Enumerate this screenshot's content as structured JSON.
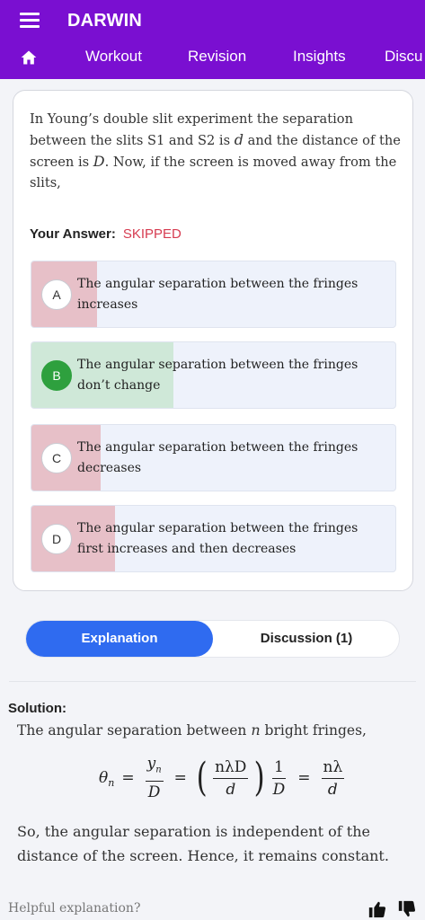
{
  "app": {
    "title": "DARWIN"
  },
  "nav": {
    "tabs": [
      {
        "label": "Workout"
      },
      {
        "label": "Revision"
      },
      {
        "label": "Insights"
      },
      {
        "label": "Discu"
      }
    ]
  },
  "question": {
    "text_part1": "In Young’s double slit experiment the separation between the slits S1 and S2 is ",
    "symbol_d": "d",
    "text_part2": " and the distance of the screen is ",
    "symbol_D": "D",
    "text_part3": ". Now, if the screen is moved away from the slits,"
  },
  "answer": {
    "label": "Your Answer:",
    "status": "SKIPPED"
  },
  "options": [
    {
      "letter": "A",
      "text": "The angular separation between the fringes increases",
      "state": "wrong",
      "fill_fraction": 0.18
    },
    {
      "letter": "B",
      "text": "The angular separation between the fringes don’t change",
      "state": "correct",
      "fill_fraction": 0.39
    },
    {
      "letter": "C",
      "text": "The angular separation between the fringes decreases",
      "state": "wrong",
      "fill_fraction": 0.19
    },
    {
      "letter": "D",
      "text": "The angular separation between the fringes first increases and then decreases",
      "state": "wrong",
      "fill_fraction": 0.23
    }
  ],
  "segment": {
    "explanation": "Explanation",
    "discussion": "Discussion (1)"
  },
  "solution": {
    "title": "Solution:",
    "line1_a": "The angular separation between ",
    "line1_n": "n",
    "line1_b": " bright fringes,",
    "formula": {
      "theta": "θ",
      "sub_n": "n",
      "y": "y",
      "D": "D",
      "num2": "nλD",
      "den2": "d",
      "one": "1",
      "num4": "nλ",
      "den4": "d"
    },
    "paragraph": "So, the angular separation is independent of the distance of the screen. Hence, it remains constant."
  },
  "feedback": {
    "prompt": "Helpful explanation?"
  },
  "colors": {
    "header": "#7a0fd1",
    "skipped": "#d63b50",
    "correct": "#2ea03e",
    "wrong_fill": "#e7c0c8",
    "correct_fill": "#cfe8d8",
    "active_segment": "#2f6bf0"
  },
  "icons": [
    "menu-icon",
    "home-icon",
    "thumbs-up-icon",
    "thumbs-down-icon"
  ]
}
